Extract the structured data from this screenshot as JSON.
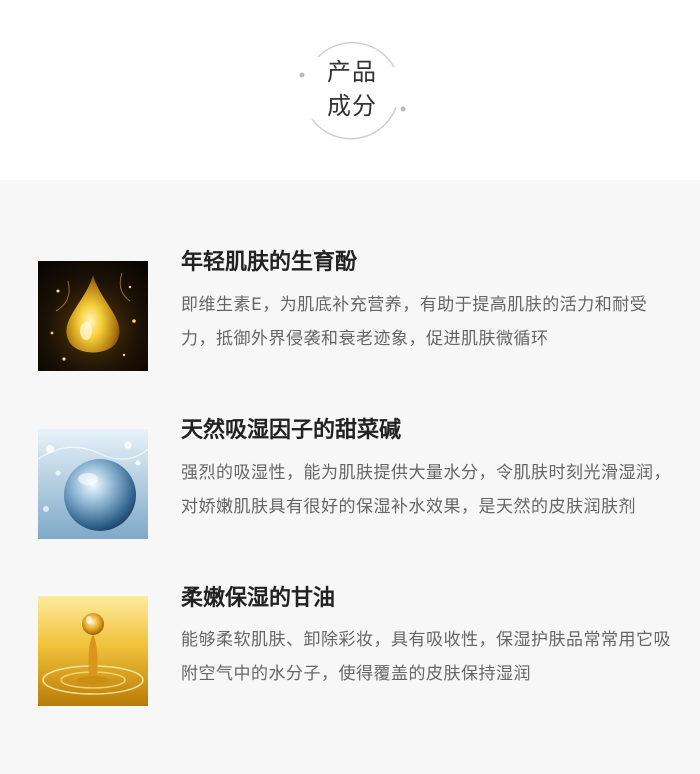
{
  "header": {
    "badge_line1": "产品",
    "badge_line2": "成分"
  },
  "ingredients": [
    {
      "title": "年轻肌肤的生育酚",
      "description": "即维生素E，为肌底补充营养，有助于提高肌肤的活力和耐受力，抵御外界侵袭和衰老迹象，促进肌肤微循环",
      "image_icon": "golden-oil-drop"
    },
    {
      "title": "天然吸湿因子的甜菜碱",
      "description": "强烈的吸湿性，能为肌肤提供大量水分，令肌肤时刻光滑湿润，对娇嫩肌肤具有很好的保湿补水效果，是天然的皮肤润肤剂",
      "image_icon": "water-sphere"
    },
    {
      "title": "柔嫩保湿的甘油",
      "description": "能够柔软肌肤、卸除彩妆，具有吸收性，保湿护肤品常常用它吸附空气中的水分子，使得覆盖的皮肤保持湿润",
      "image_icon": "oil-drip-splash"
    }
  ],
  "colors": {
    "background_top": "#ffffff",
    "background_content": "#f7f7f7",
    "title_text": "#222222",
    "body_text": "#666666",
    "badge_ring": "#cccccc"
  }
}
